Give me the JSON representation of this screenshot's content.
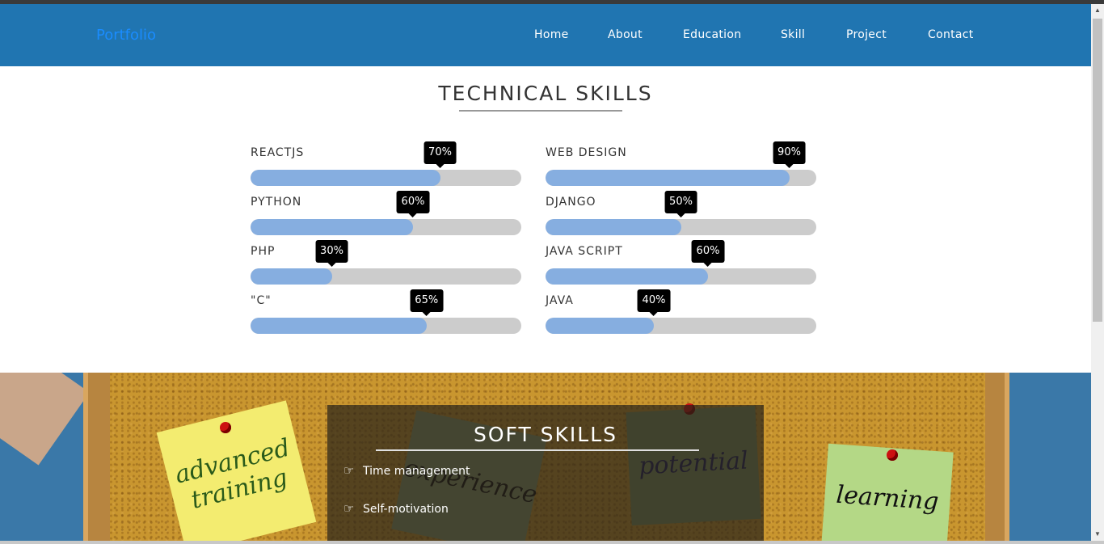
{
  "navbar": {
    "brand": "Portfolio",
    "links": [
      "Home",
      "About",
      "Education",
      "Skill",
      "Project",
      "Contact"
    ]
  },
  "technical": {
    "title": "TECHNICAL SKILLS",
    "left": [
      {
        "label": "REACTJS",
        "percent": 70,
        "text": "70%"
      },
      {
        "label": "PYTHON",
        "percent": 60,
        "text": "60%"
      },
      {
        "label": "PHP",
        "percent": 30,
        "text": "30%"
      },
      {
        "label": "\"C\"",
        "percent": 65,
        "text": "65%"
      }
    ],
    "right": [
      {
        "label": "WEB DESIGN",
        "percent": 90,
        "text": "90%"
      },
      {
        "label": "DJANGO",
        "percent": 50,
        "text": "50%"
      },
      {
        "label": "JAVA SCRIPT",
        "percent": 60,
        "text": "60%"
      },
      {
        "label": "JAVA",
        "percent": 40,
        "text": "40%"
      }
    ],
    "colors": {
      "fill": "#86aee0",
      "track": "#cccccc",
      "tooltip": "#000000"
    }
  },
  "soft": {
    "title": "SOFT SKILLS",
    "items": [
      "Time management",
      "Self-motivation"
    ],
    "icon": "hand-pointing-right-icon",
    "notes": [
      "advanced training",
      "experience",
      "potential",
      "learning"
    ]
  },
  "colors": {
    "navbar": "#2075b1",
    "brand": "#1a8cff"
  }
}
